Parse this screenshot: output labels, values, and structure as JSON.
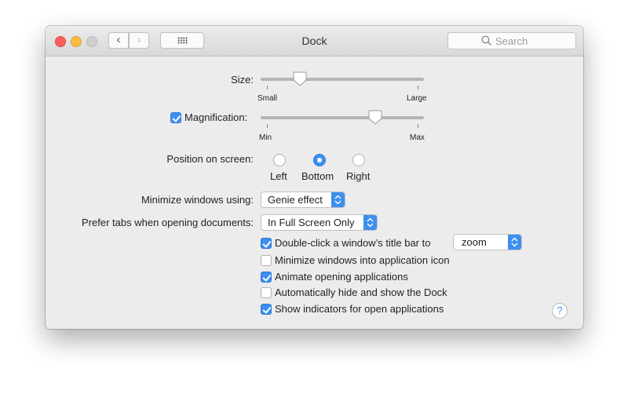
{
  "window": {
    "title": "Dock",
    "search_placeholder": "Search"
  },
  "size": {
    "label": "Size:",
    "min_label": "Small",
    "max_label": "Large",
    "value": 0.22
  },
  "magnification": {
    "label": "Magnification:",
    "checked": true,
    "min_label": "Min",
    "max_label": "Max",
    "value": 0.72
  },
  "position": {
    "label": "Position on screen:",
    "options": [
      "Left",
      "Bottom",
      "Right"
    ],
    "selected": "Bottom"
  },
  "minimize": {
    "label": "Minimize windows using:",
    "value": "Genie effect"
  },
  "prefer_tabs": {
    "label": "Prefer tabs when opening documents:",
    "value": "In Full Screen Only"
  },
  "options": {
    "double_click": {
      "label": "Double-click a window’s title bar to",
      "checked": true,
      "action": "zoom"
    },
    "minimize_into_icon": {
      "label": "Minimize windows into application icon",
      "checked": false
    },
    "animate": {
      "label": "Animate opening applications",
      "checked": true
    },
    "autohide": {
      "label": "Automatically hide and show the Dock",
      "checked": false
    },
    "indicators": {
      "label": "Show indicators for open applications",
      "checked": true
    }
  },
  "help": {
    "label": "?"
  },
  "colors": {
    "accent": "#3d8fef",
    "annotation_arrow": "#e8402f"
  },
  "icons": [
    "back-chevron-icon",
    "forward-chevron-icon",
    "grid-icon",
    "search-icon",
    "help-icon"
  ]
}
